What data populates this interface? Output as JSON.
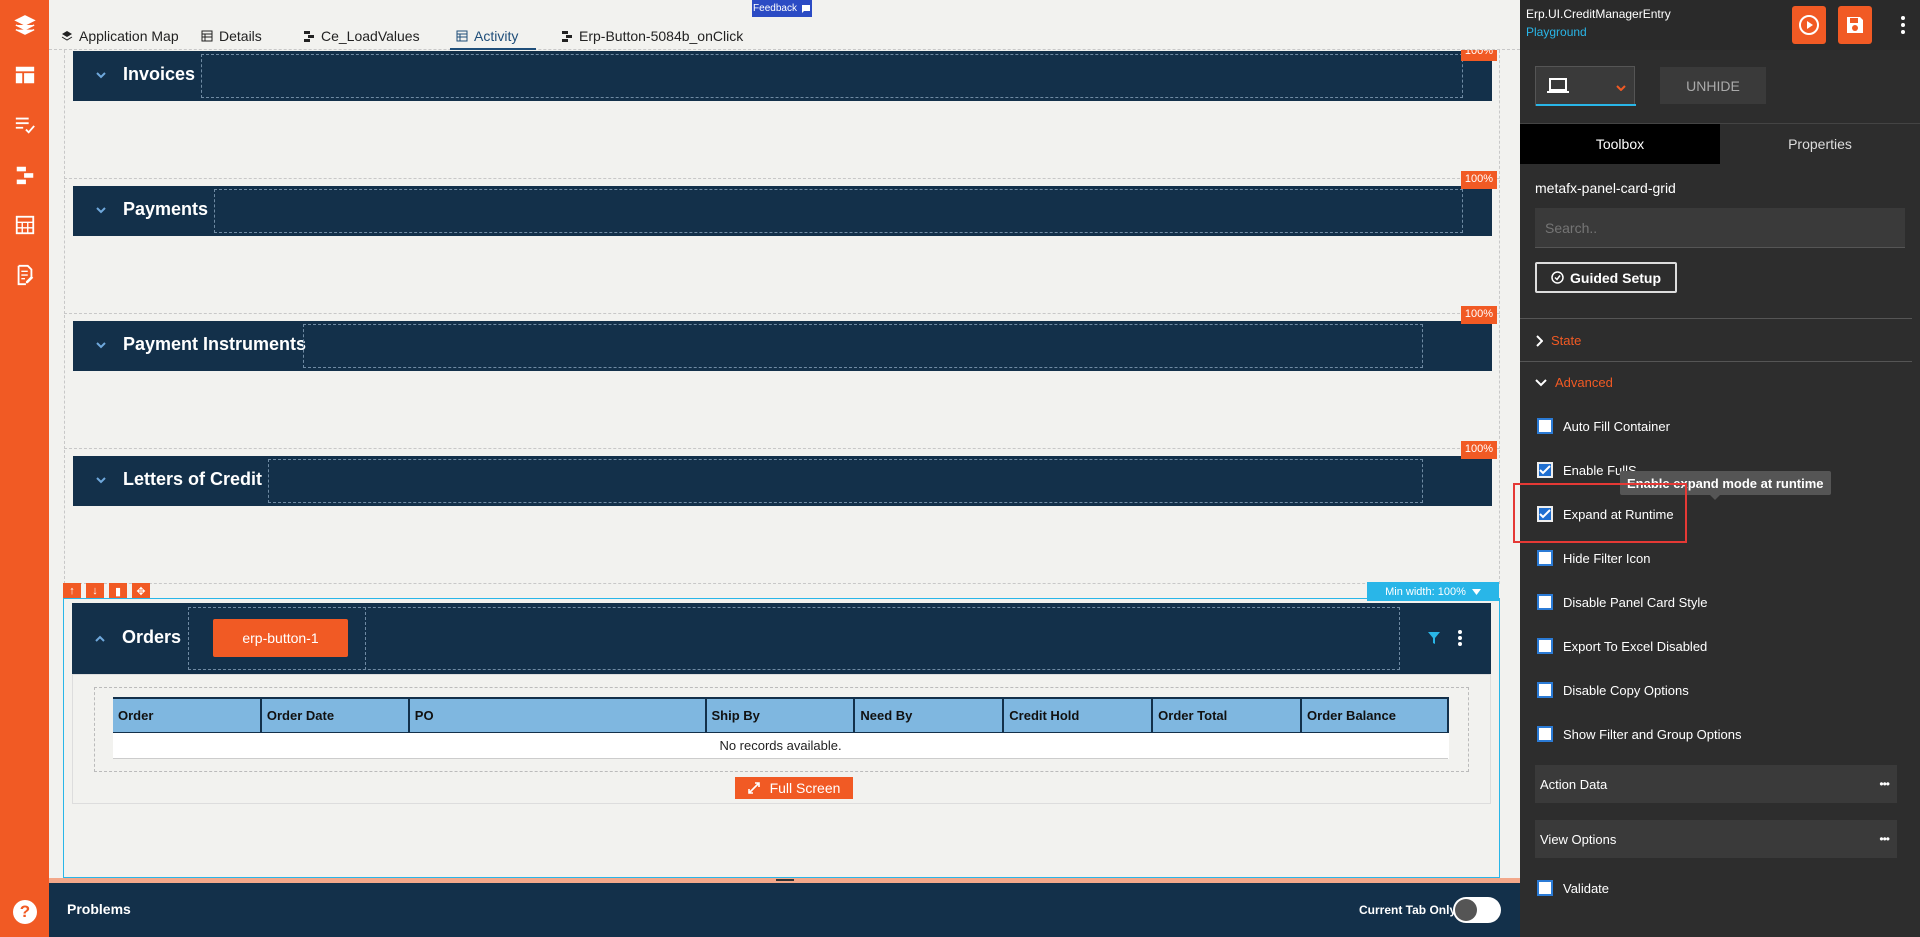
{
  "tabs": [
    {
      "label": "Application Map",
      "icon": "layers-icon"
    },
    {
      "label": "Details",
      "icon": "table-icon"
    },
    {
      "label": "Ce_LoadValues",
      "icon": "flow-icon"
    },
    {
      "label": "Activity",
      "icon": "table-icon",
      "active": true
    },
    {
      "label": "Erp-Button-5084b_onClick",
      "icon": "flow-icon"
    }
  ],
  "feedback": {
    "label": "Feedback"
  },
  "sections": [
    {
      "title": "Invoices",
      "pct": "100%"
    },
    {
      "title": "Payments",
      "pct": "100%"
    },
    {
      "title": "Payment Instruments",
      "pct": "100%"
    },
    {
      "title": "Letters of Credit",
      "pct": "100%"
    }
  ],
  "orders": {
    "title": "Orders",
    "min_width": "Min width: 100%",
    "button_label": "erp-button-1",
    "columns": [
      "Order",
      "Order Date",
      "PO",
      "Ship By",
      "Need By",
      "Credit Hold",
      "Order Total",
      "Order Balance"
    ],
    "empty_text": "No records available.",
    "fullscreen_label": "Full Screen"
  },
  "problems": {
    "label": "Problems",
    "current_tab_only": "Current Tab Only",
    "toggle_on": false
  },
  "right_panel": {
    "app_name": "Erp.UI.CreditManagerEntry",
    "env_name": "Playground",
    "unhide_label": "UNHIDE",
    "tab_toolbox": "Toolbox",
    "tab_properties": "Properties",
    "component_name": "metafx-panel-card-grid",
    "search_placeholder": "Search..",
    "guided_setup": "Guided Setup",
    "state_label": "State",
    "advanced_label": "Advanced",
    "options": [
      {
        "label": "Auto Fill Container",
        "checked": false
      },
      {
        "label": "Enable FullS",
        "checked": true
      },
      {
        "label": "Expand at Runtime",
        "checked": true
      },
      {
        "label": "Hide Filter Icon",
        "checked": false
      },
      {
        "label": "Disable Panel Card Style",
        "checked": false
      },
      {
        "label": "Export To Excel Disabled",
        "checked": false
      },
      {
        "label": "Disable Copy Options",
        "checked": false
      },
      {
        "label": "Show Filter and Group Options",
        "checked": false
      }
    ],
    "tooltip": "Enable expand mode at runtime",
    "action_data": "Action Data",
    "view_options": "View Options",
    "validate": {
      "label": "Validate",
      "checked": false
    }
  },
  "colors": {
    "brand": "#f15a24",
    "navy": "#13304a",
    "accent": "#29b6e8"
  }
}
